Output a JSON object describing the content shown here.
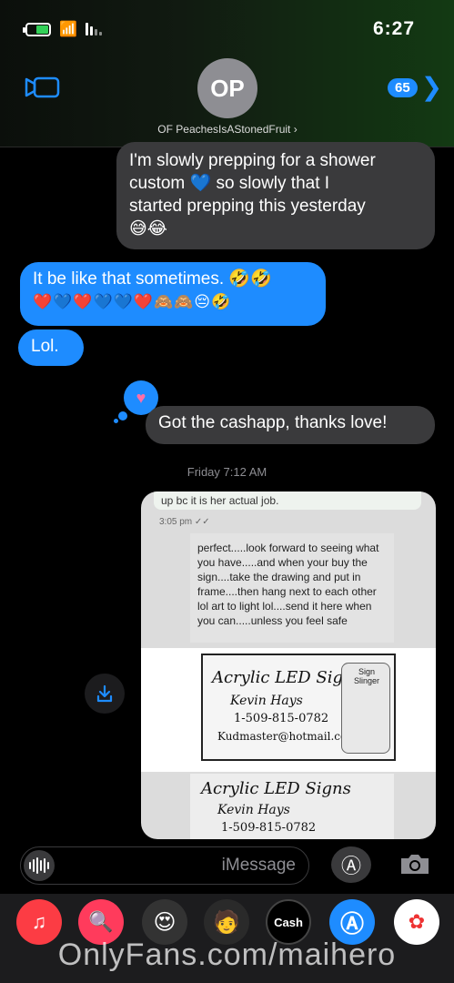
{
  "status_bar": {
    "time": "6:27"
  },
  "header": {
    "back_badge": "65",
    "back_chevron": "❯",
    "avatar_initials": "OP",
    "contact_name": "OF PeachesIsAStonedFruit ›",
    "colors": {
      "accent": "#1e8cff",
      "avatar_bg": "#8e8e93"
    }
  },
  "messages": [
    {
      "side": "received",
      "text_lines": [
        "I'm slowly prepping for a shower",
        "custom 💙 so slowly that I",
        "started prepping this yesterday"
      ],
      "emoji_line": "😅😂"
    },
    {
      "side": "sent",
      "text": "It be like that sometimes. 🤣🤣",
      "emoji_line": "❤️💙❤️💙💙❤️🙈🙈😔🤣"
    },
    {
      "side": "sent",
      "text": "Lol."
    },
    {
      "side": "received",
      "text": "Got the cashapp, thanks love!",
      "tapback": "♥"
    }
  ],
  "timestamp": "Friday 7:12 AM",
  "attachment": {
    "chat_top": "up bc it is her actual job.",
    "chat_time": "3:05 pm ✓✓",
    "chat_message": "perfect.....look forward to seeing what you have.....and when your buy the sign....take the drawing and put in frame....then hang next to each other lol art to light lol....send it here when you can.....unless you feel safe",
    "card": {
      "title": "Acrylic LED Signs",
      "name": "Kevin Hays",
      "phone": "1-509-815-0782",
      "email": "Kudmaster@hotmail.com",
      "art_label": "Sign Slinger"
    },
    "lower": {
      "title": "Acrylic LED Signs",
      "name": "Kevin Hays",
      "phone": "1-509-815-0782"
    }
  },
  "input": {
    "placeholder": "iMessage"
  },
  "apps": {
    "cash_label": "Cash"
  },
  "watermark": "OnlyFans.com/maihero"
}
